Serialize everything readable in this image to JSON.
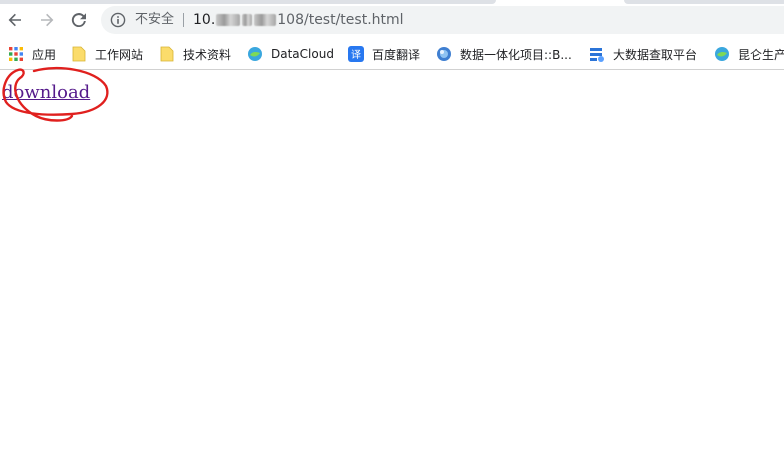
{
  "toolbar": {
    "security_label": "不安全",
    "url_host_prefix": "10.",
    "url_path": "108/test/test.html"
  },
  "bookmarks": [
    {
      "label": "应用",
      "icon": "apps-grid-icon"
    },
    {
      "label": "工作网站",
      "icon": "folder-icon"
    },
    {
      "label": "技术资料",
      "icon": "folder-icon"
    },
    {
      "label": "DataCloud",
      "icon": "cloud-globe-icon"
    },
    {
      "label": "百度翻译",
      "icon": "translate-icon"
    },
    {
      "label": "数据一体化项目::B...",
      "icon": "globe-icon"
    },
    {
      "label": "大数据查取平台",
      "icon": "data-platform-icon"
    },
    {
      "label": "昆仑生产",
      "icon": "cloud-globe-icon"
    }
  ],
  "page": {
    "link_text": "download"
  },
  "colors": {
    "link_visited": "#551a8b",
    "annotation": "#e0201e",
    "omnibox_bg": "#f1f3f4"
  }
}
